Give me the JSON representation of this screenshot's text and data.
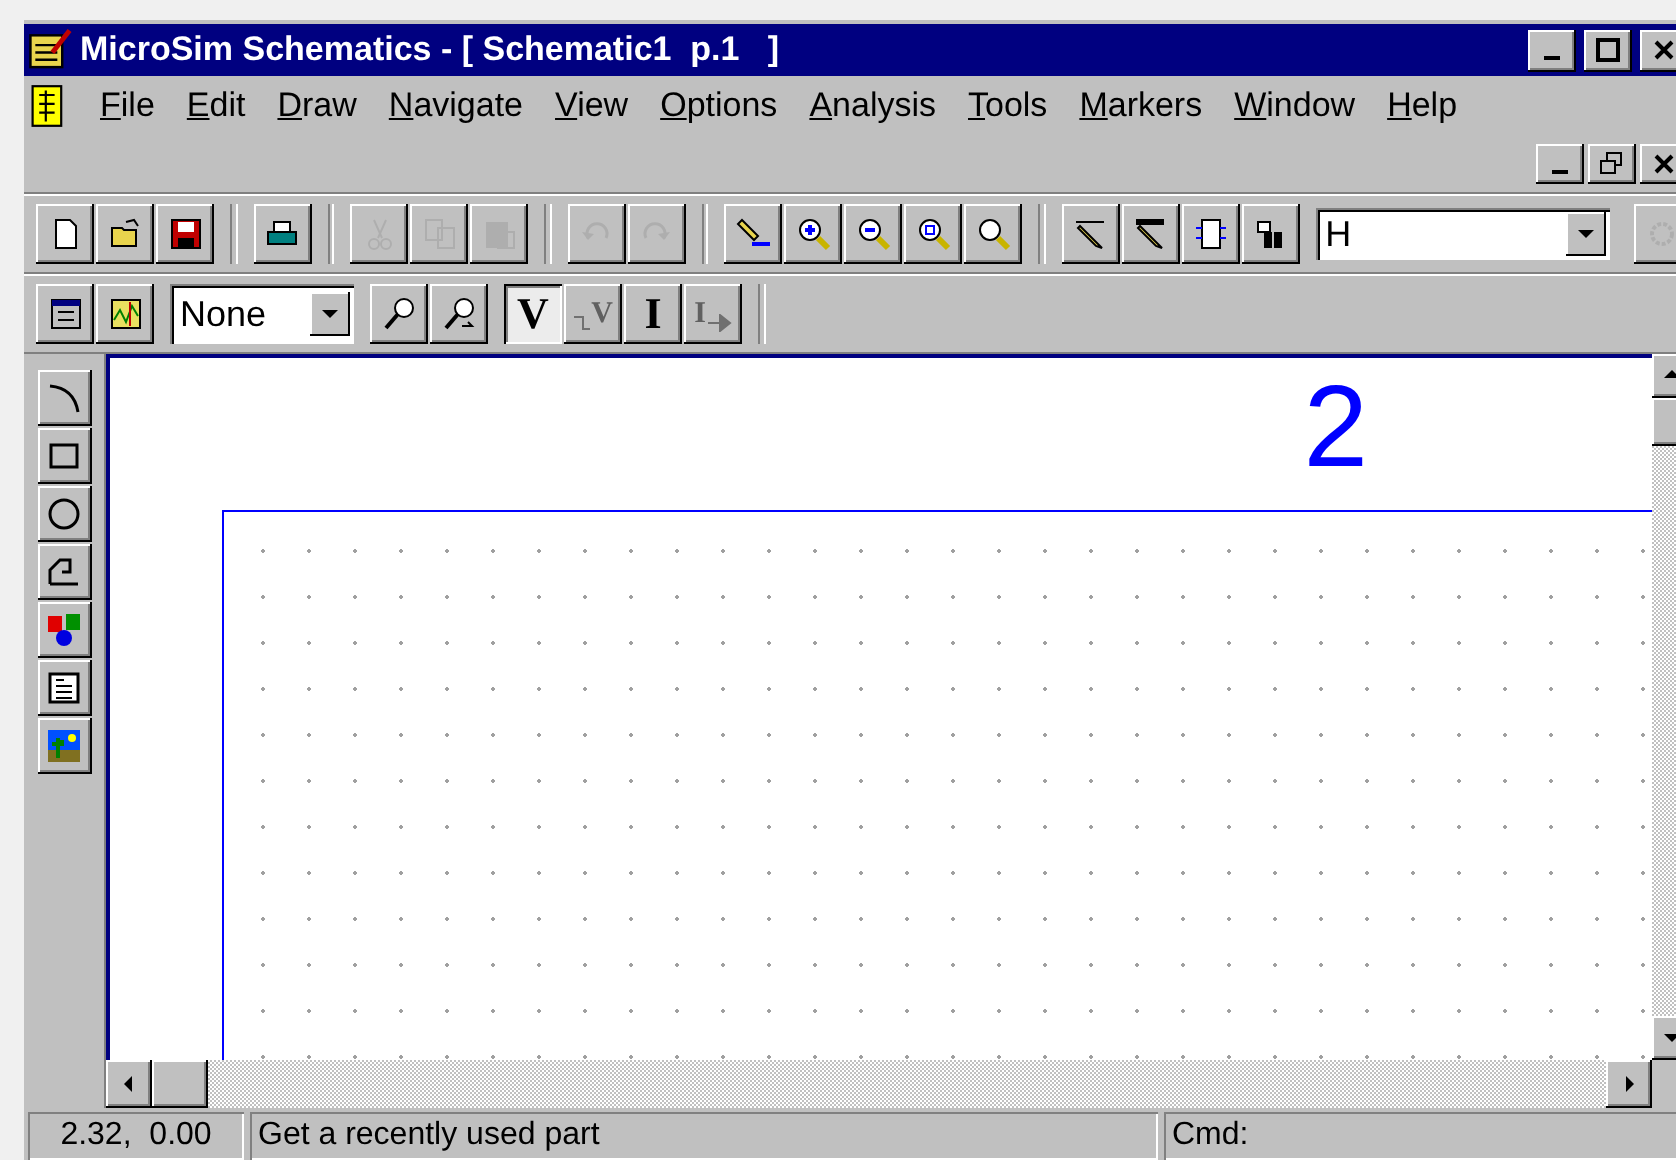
{
  "window": {
    "title": "MicroSim Schematics - [ Schematic1  p.1   ]"
  },
  "menu": [
    "File",
    "Edit",
    "Draw",
    "Navigate",
    "View",
    "Options",
    "Analysis",
    "Tools",
    "Markers",
    "Window",
    "Help"
  ],
  "toolbar": {
    "groups": [
      [
        {
          "kind": "new",
          "disabled": false
        },
        {
          "kind": "open",
          "disabled": false
        },
        {
          "kind": "save",
          "disabled": false
        }
      ],
      [
        {
          "kind": "print",
          "disabled": false
        }
      ],
      [
        {
          "kind": "cut",
          "disabled": true
        },
        {
          "kind": "copy",
          "disabled": true
        },
        {
          "kind": "paste",
          "disabled": true
        }
      ],
      [
        {
          "kind": "undo",
          "disabled": true
        },
        {
          "kind": "redo",
          "disabled": true
        }
      ],
      [
        {
          "kind": "highlight",
          "disabled": false
        },
        {
          "kind": "zoom-in",
          "disabled": false
        },
        {
          "kind": "zoom-out",
          "disabled": false
        },
        {
          "kind": "zoom-area",
          "disabled": false
        },
        {
          "kind": "zoom-fit",
          "disabled": false
        }
      ],
      [
        {
          "kind": "wire",
          "disabled": false
        },
        {
          "kind": "bus",
          "disabled": false
        },
        {
          "kind": "block",
          "disabled": false
        },
        {
          "kind": "get-part",
          "disabled": false
        }
      ]
    ],
    "part_field": {
      "value": "H"
    },
    "trailing": {
      "kind": "gear",
      "disabled": true
    }
  },
  "toolbar2": {
    "lead": [
      {
        "kind": "list",
        "disabled": false
      },
      {
        "kind": "plot",
        "disabled": false
      }
    ],
    "profile_select": {
      "value": "None"
    },
    "probes": [
      {
        "kind": "probe-v",
        "disabled": false
      },
      {
        "kind": "probe-i",
        "disabled": false
      }
    ],
    "markers": [
      {
        "kind": "plain",
        "label": "V",
        "selected": true,
        "disabled": false
      },
      {
        "kind": "wire",
        "label": "V",
        "selected": false,
        "disabled": true
      },
      {
        "kind": "plain",
        "label": "I",
        "selected": false,
        "disabled": false
      },
      {
        "kind": "arrow",
        "label": "I",
        "selected": false,
        "disabled": true
      }
    ]
  },
  "draw_tools": [
    {
      "kind": "arc"
    },
    {
      "kind": "box"
    },
    {
      "kind": "circle"
    },
    {
      "kind": "polyline"
    },
    {
      "kind": "text"
    },
    {
      "kind": "text-box"
    },
    {
      "kind": "picture"
    }
  ],
  "canvas": {
    "sheet_label": "2"
  },
  "status_bar": {
    "coordinates": "2.32,  0.00",
    "message": "Get a recently used part",
    "command": "Cmd:"
  }
}
